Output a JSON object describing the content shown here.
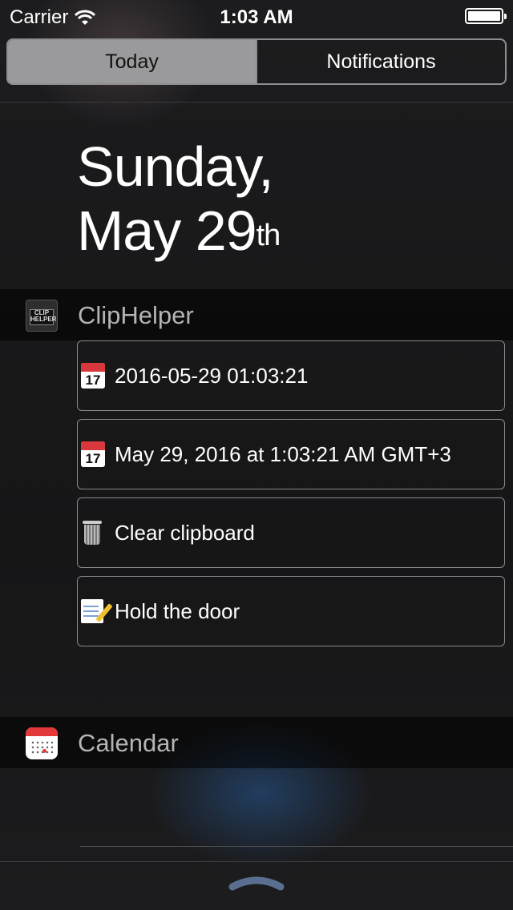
{
  "status_bar": {
    "carrier": "Carrier",
    "time": "1:03 AM"
  },
  "segmented": {
    "today": "Today",
    "notifications": "Notifications",
    "selected": "Today"
  },
  "date_header": {
    "line1": "Sunday,",
    "line2": "May 29",
    "suffix": "th"
  },
  "widgets": {
    "cliphelper": {
      "title": "ClipHelper",
      "icon_text": "CLIP HELPER",
      "items": [
        {
          "icon": "calendar-emoji-icon",
          "icon_num": "17",
          "label": "2016-05-29 01:03:21"
        },
        {
          "icon": "calendar-emoji-icon",
          "icon_num": "17",
          "label": "May 29, 2016 at 1:03:21 AM GMT+3"
        },
        {
          "icon": "trash-can-icon",
          "label": "Clear clipboard"
        },
        {
          "icon": "memo-pencil-icon",
          "label": "Hold the door"
        }
      ]
    },
    "calendar": {
      "title": "Calendar"
    }
  },
  "colors": {
    "background": "#1b1b1d",
    "segment_selected": "#9a9a9c",
    "calendar_red": "#e5383b"
  }
}
